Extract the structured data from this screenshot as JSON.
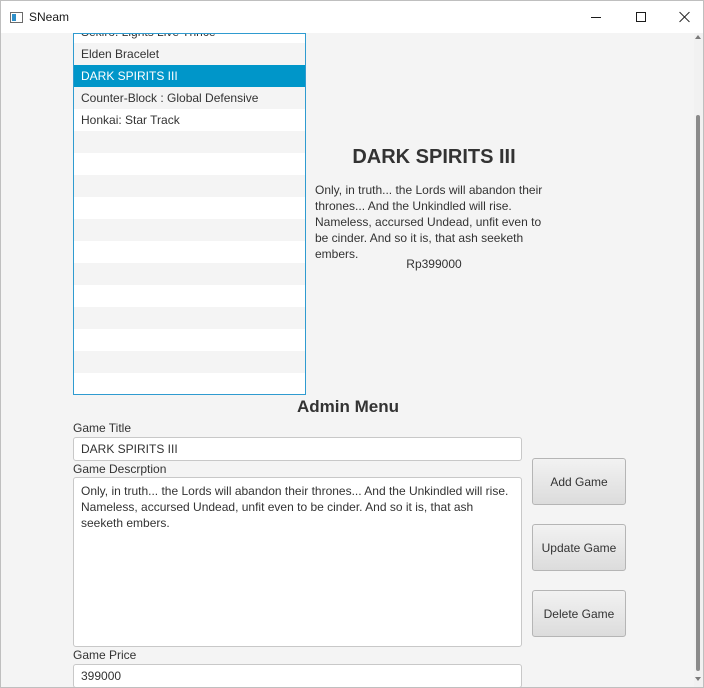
{
  "window": {
    "title": "SNeam"
  },
  "list": {
    "items": [
      "Sekiro: Lights Live Thrice",
      "Elden Bracelet",
      "DARK SPIRITS III",
      "Counter-Block : Global Defensive",
      "Honkai: Star Track"
    ],
    "selected_index": 2
  },
  "details": {
    "title": "DARK SPIRITS III",
    "description": "Only, in truth... the Lords will abandon their thrones... And the Unkindled will rise. Nameless, accursed Undead, unfit even to be cinder. And so it is, that ash seeketh embers.",
    "price": "Rp399000"
  },
  "admin": {
    "heading": "Admin Menu",
    "title_label": "Game Title",
    "title_value": "DARK SPIRITS III",
    "desc_label": "Game Descrption",
    "desc_value": "Only, in truth... the Lords will abandon their thrones... And the Unkindled will rise. Nameless, accursed Undead, unfit even to be cinder. And so it is, that ash seeketh embers.",
    "price_label": "Game Price",
    "price_value": "399000",
    "add_label": "Add Game",
    "update_label": "Update Game",
    "delete_label": "Delete Game"
  },
  "colors": {
    "selection": "#0096c9",
    "list_border": "#2f9bd0"
  }
}
